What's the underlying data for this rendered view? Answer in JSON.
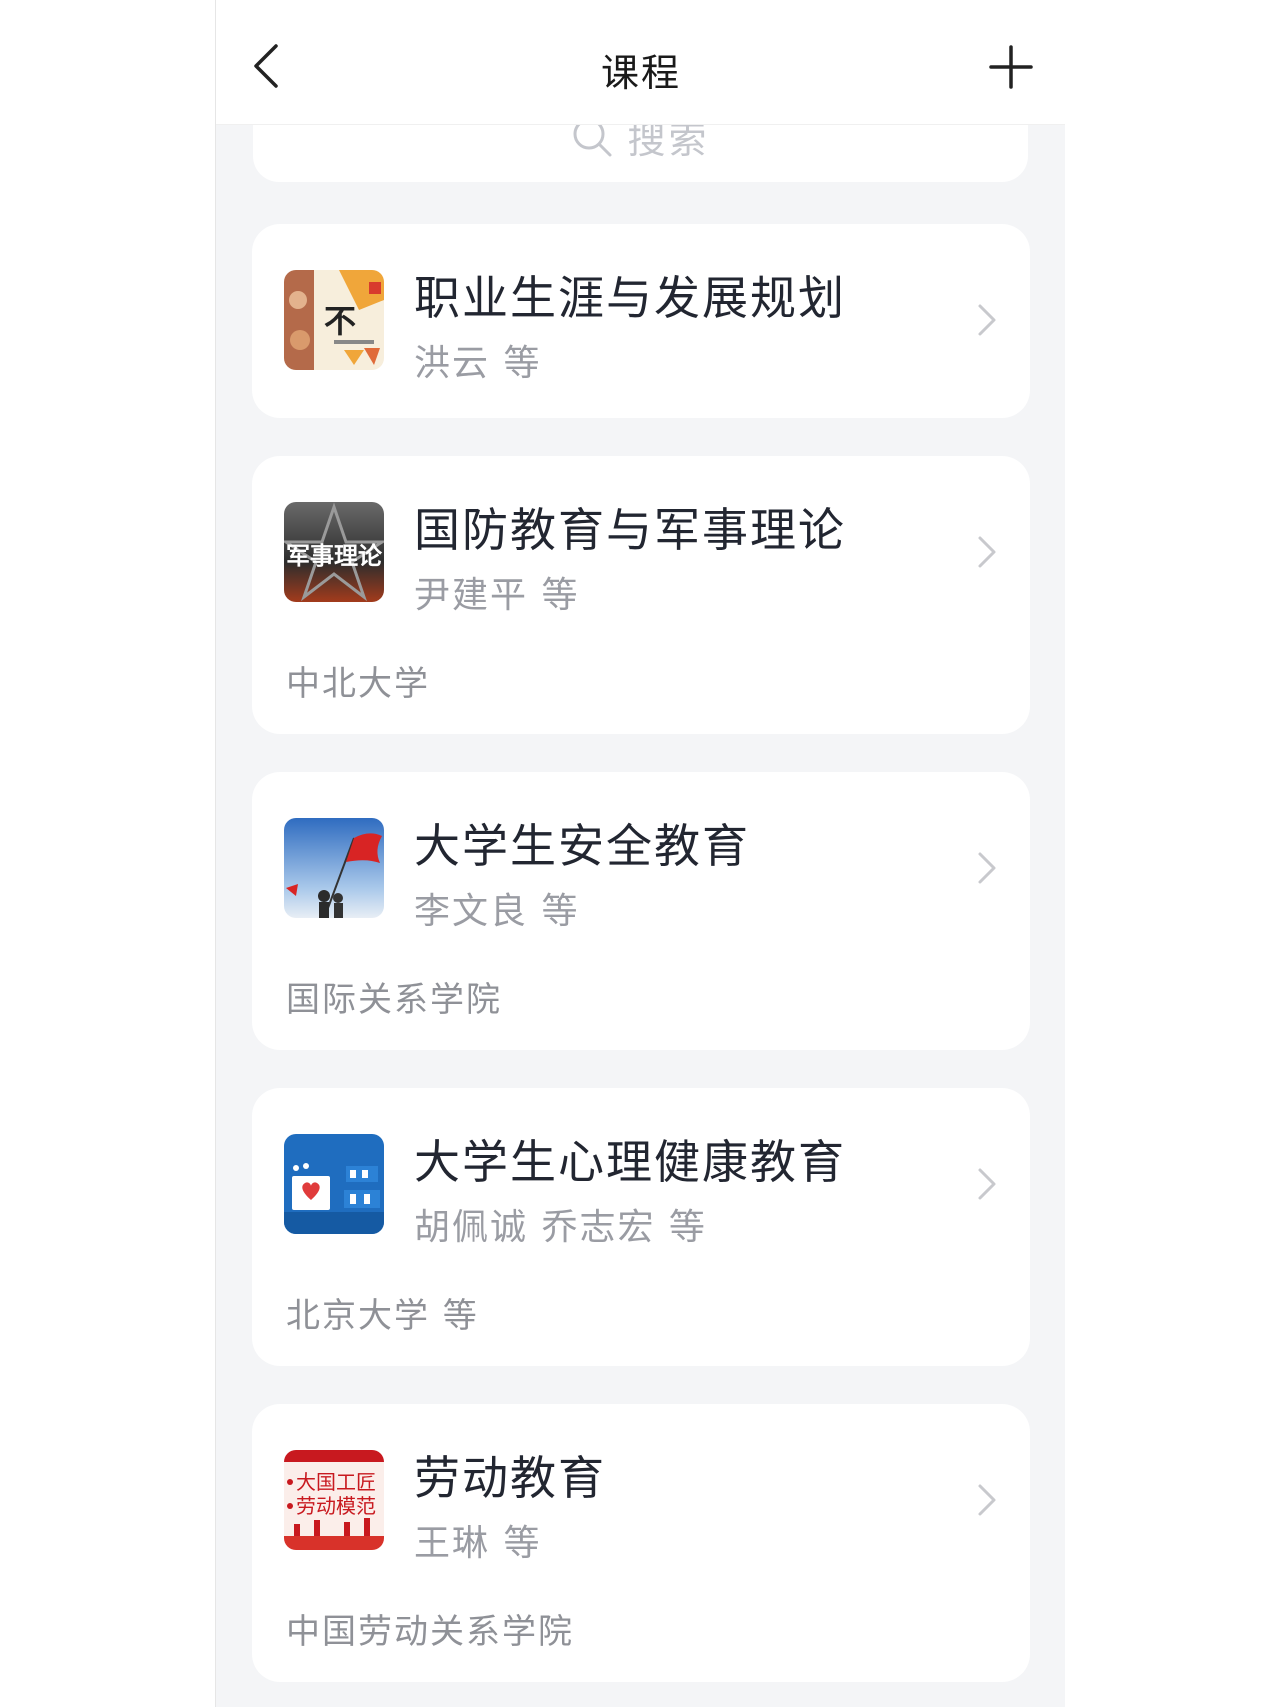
{
  "header": {
    "title": "课程"
  },
  "search": {
    "placeholder": "搜索"
  },
  "courses": [
    {
      "title": "职业生涯与发展规划",
      "teachers": "洪云 等",
      "school": ""
    },
    {
      "title": "国防教育与军事理论",
      "teachers": "尹建平 等",
      "school": "中北大学",
      "cover_text": "军事理论"
    },
    {
      "title": "大学生安全教育",
      "teachers": "李文良 等",
      "school": "国际关系学院"
    },
    {
      "title": "大学生心理健康教育",
      "teachers": "胡佩诚 乔志宏 等",
      "school": "北京大学 等"
    },
    {
      "title": "劳动教育",
      "teachers": "王琳 等",
      "school": "中国劳动关系学院",
      "cover_text": [
        "大国工匠",
        "劳动模范"
      ]
    }
  ],
  "colors": {
    "background": "#f4f5f7",
    "card": "#ffffff",
    "title_text": "#222631",
    "secondary_text": "#9a9ca3"
  }
}
